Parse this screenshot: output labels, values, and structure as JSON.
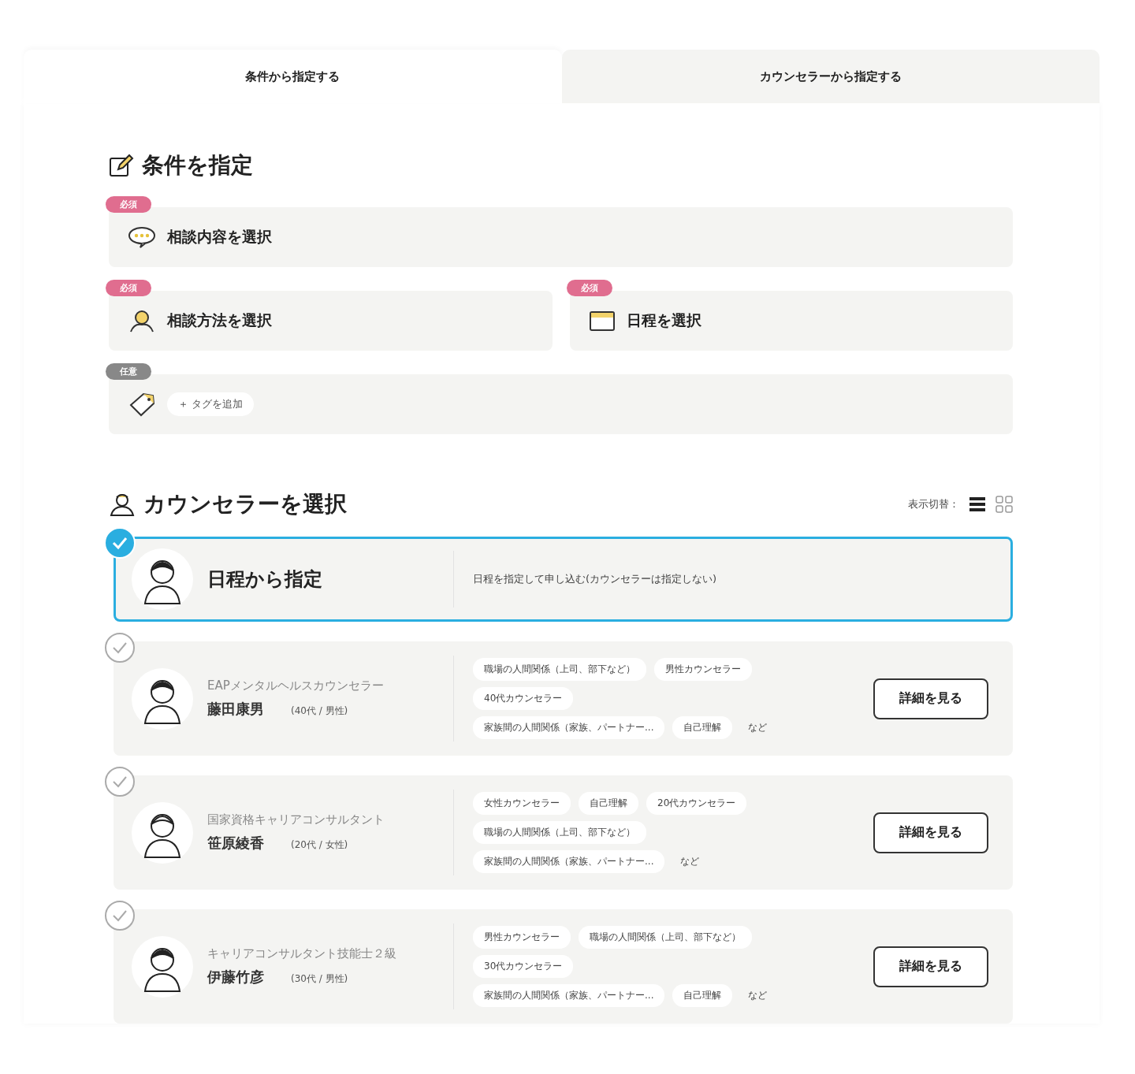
{
  "tabs": [
    {
      "label": "条件から指定する",
      "selected": true
    },
    {
      "label": "カウンセラーから指定する",
      "selected": false
    }
  ],
  "conditions": {
    "title": "条件を指定",
    "rows": [
      [
        {
          "badge": "必須",
          "required": true,
          "kind": "chat",
          "label": "相談内容を選択"
        }
      ],
      [
        {
          "badge": "必須",
          "required": true,
          "kind": "person",
          "label": "相談方法を選択"
        },
        {
          "badge": "必須",
          "required": true,
          "kind": "calendar",
          "label": "日程を選択"
        }
      ],
      [
        {
          "badge": "任意",
          "required": false,
          "kind": "tag",
          "chip": "＋ タグを追加"
        }
      ]
    ]
  },
  "counselors": {
    "title": "カウンセラーを選択",
    "view_label": "表示切替：",
    "view_modes": [
      {
        "kind": "list",
        "selected": true
      },
      {
        "kind": "grid",
        "selected": false
      }
    ],
    "items": [
      {
        "kind": "schedule",
        "selected": true,
        "title": "日程から指定",
        "description": "日程を指定して申し込む(カウンセラーは指定しない)"
      },
      {
        "kind": "counselor",
        "selected": false,
        "qualification": "EAPメンタルヘルスカウンセラー",
        "name": "藤田康男",
        "profile": "(40代 / 男性)",
        "tags": [
          [
            "職場の人間関係（上司、部下など）",
            "男性カウンセラー"
          ],
          [
            "40代カウンセラー"
          ],
          [
            "家族間の人間関係（家族、パートナー...",
            "自己理解"
          ]
        ],
        "more": "など",
        "button": "詳細を見る"
      },
      {
        "kind": "counselor",
        "selected": false,
        "qualification": "国家資格キャリアコンサルタント",
        "name": "笹原綾香",
        "profile": "(20代 / 女性)",
        "tags": [
          [
            "女性カウンセラー",
            "自己理解",
            "20代カウンセラー"
          ],
          [
            "職場の人間関係（上司、部下など）"
          ],
          [
            "家族間の人間関係（家族、パートナー..."
          ]
        ],
        "more": "など",
        "button": "詳細を見る"
      },
      {
        "kind": "counselor",
        "selected": false,
        "qualification": "キャリアコンサルタント技能士２級",
        "name": "伊藤竹彦",
        "profile": "(30代 / 男性)",
        "tags": [
          [
            "男性カウンセラー",
            "職場の人間関係（上司、部下など）"
          ],
          [
            "30代カウンセラー"
          ],
          [
            "家族間の人間関係（家族、パートナー...",
            "自己理解"
          ]
        ],
        "more": "など",
        "button": "詳細を見る"
      }
    ]
  }
}
